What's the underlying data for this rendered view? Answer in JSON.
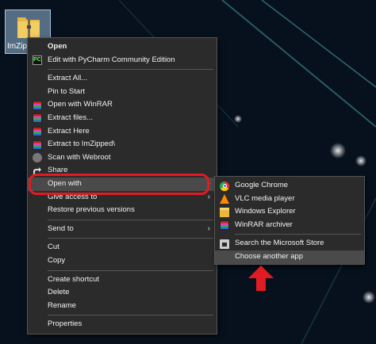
{
  "desktop": {
    "icon_label": "ImZipped"
  },
  "context_menu": {
    "items": [
      {
        "label": "Open",
        "icon": "",
        "bold": true
      },
      {
        "label": "Edit with PyCharm Community Edition",
        "icon": "pycharm-icon",
        "icon_text": "PC"
      },
      {
        "separator": true
      },
      {
        "label": "Extract All...",
        "icon": ""
      },
      {
        "label": "Pin to Start",
        "icon": ""
      },
      {
        "label": "Open with WinRAR",
        "icon": "winrar-icon"
      },
      {
        "label": "Extract files...",
        "icon": "winrar-icon"
      },
      {
        "label": "Extract Here",
        "icon": "winrar-icon"
      },
      {
        "label": "Extract to ImZipped\\",
        "icon": "winrar-icon"
      },
      {
        "label": "Scan with Webroot",
        "icon": "webroot-icon"
      },
      {
        "label": "Share",
        "icon": "share-icon"
      },
      {
        "label": "Open with",
        "icon": "",
        "submenu": true,
        "highlight": true
      },
      {
        "label": "Give access to",
        "icon": "",
        "submenu": true
      },
      {
        "label": "Restore previous versions",
        "icon": ""
      },
      {
        "separator": true
      },
      {
        "label": "Send to",
        "icon": "",
        "submenu": true
      },
      {
        "separator": true
      },
      {
        "label": "Cut",
        "icon": ""
      },
      {
        "label": "Copy",
        "icon": ""
      },
      {
        "separator": true
      },
      {
        "label": "Create shortcut",
        "icon": ""
      },
      {
        "label": "Delete",
        "icon": ""
      },
      {
        "label": "Rename",
        "icon": ""
      },
      {
        "separator": true
      },
      {
        "label": "Properties",
        "icon": ""
      }
    ]
  },
  "open_with_submenu": {
    "items": [
      {
        "label": "Google Chrome",
        "icon": "chrome-icon"
      },
      {
        "label": "VLC media player",
        "icon": "vlc-icon"
      },
      {
        "label": "Windows Explorer",
        "icon": "explorer-icon"
      },
      {
        "label": "WinRAR archiver",
        "icon": "winrar-icon"
      },
      {
        "separator": true
      },
      {
        "label": "Search the Microsoft Store",
        "icon": "store-icon"
      },
      {
        "label": "Choose another app",
        "icon": "",
        "highlight": true
      }
    ]
  },
  "colors": {
    "menu_background": "#2b2b2b",
    "highlight": "#4a4a4a",
    "annotation_red": "#e01b22"
  }
}
